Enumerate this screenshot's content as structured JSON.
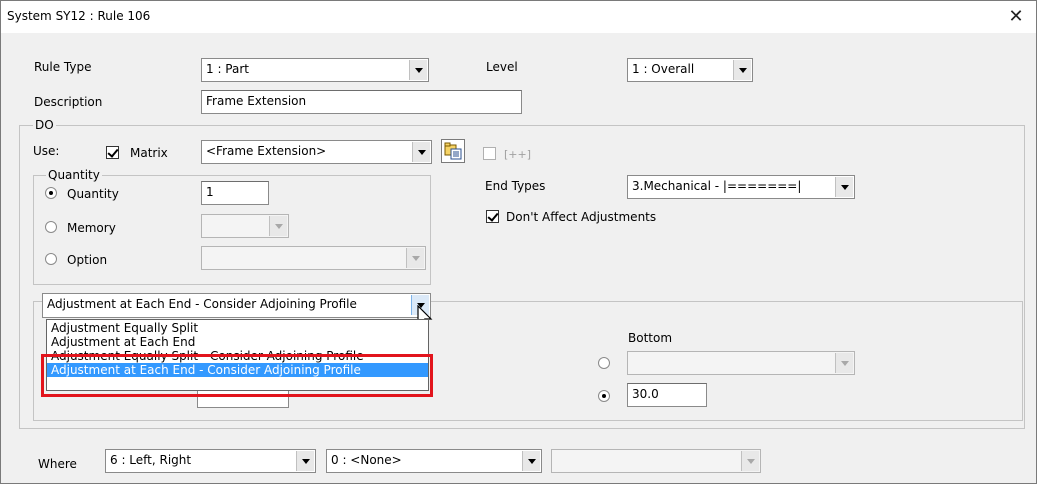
{
  "window": {
    "title": "System SY12 : Rule 106",
    "close_glyph": "✕"
  },
  "rule_type": {
    "label": "Rule Type",
    "value": "1 : Part"
  },
  "level": {
    "label": "Level",
    "value": "1 : Overall"
  },
  "description": {
    "label": "Description",
    "value": "Frame Extension"
  },
  "do_group": {
    "legend": "DO",
    "use_label": "Use:",
    "matrix_checkbox": {
      "label": "Matrix",
      "checked": true
    },
    "matrix_combo_value": "<Frame Extension>",
    "plus_checkbox": {
      "label": "[++]",
      "checked": false
    }
  },
  "quantity_group": {
    "legend": "Quantity",
    "options": [
      {
        "label": "Quantity",
        "selected": true
      },
      {
        "label": "Memory",
        "selected": false
      },
      {
        "label": "Option",
        "selected": false
      }
    ],
    "quantity_value": "1"
  },
  "end_types": {
    "label": "End Types",
    "value": "3.Mechanical    - |=======|"
  },
  "dont_affect": {
    "label": "Don't Affect Adjustments",
    "checked": true
  },
  "adjustment": {
    "selected_value": "Adjustment at Each End - Consider Adjoining Profile",
    "options": [
      "Adjustment Equally Split",
      "Adjustment at Each End",
      "Adjustment Equally Split - Consider Adjoining Profile",
      "Adjustment at Each End - Consider Adjoining Profile"
    ],
    "highlighted_index": 3
  },
  "bottom": {
    "label": "Bottom",
    "value": "30.0"
  },
  "where": {
    "label": "Where",
    "combo1": "6 : Left, Right",
    "combo2": "0 : <None>",
    "combo3": ""
  },
  "colors": {
    "highlight_red": "#e2141c",
    "selection_blue": "#3399ff"
  }
}
